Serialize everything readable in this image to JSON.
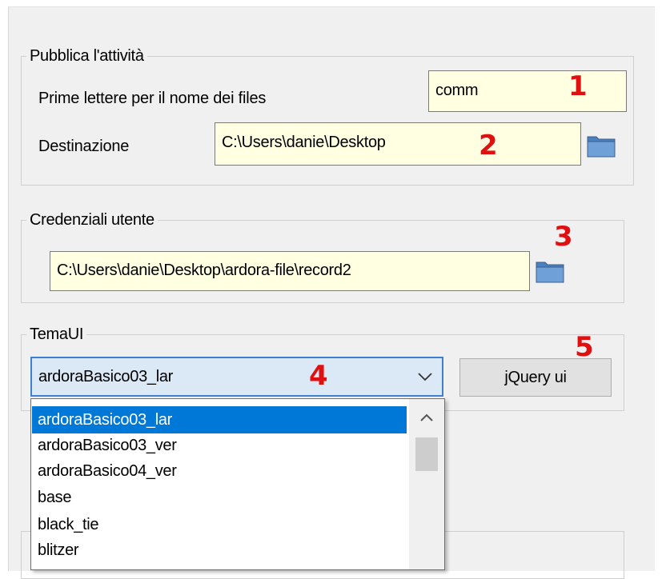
{
  "publish": {
    "legend": "Pubblica l'attività",
    "prefix_label": "Prime lettere per il nome dei files",
    "prefix_value": "comm",
    "destination_label": "Destinazione",
    "destination_value": "C:\\Users\\danie\\Desktop"
  },
  "credentials": {
    "legend": "Credenziali utente",
    "path_value": "C:\\Users\\danie\\Desktop\\ardora-file\\record2"
  },
  "theme": {
    "legend": "TemaUI",
    "selected": "ardoraBasico03_lar",
    "button_label": "jQuery ui",
    "options": [
      "ardoraBasico03_lar",
      "ardoraBasico03_ver",
      "ardoraBasico04_ver",
      "base",
      "black_tie",
      "blitzer"
    ]
  },
  "annotations": [
    "1",
    "2",
    "3",
    "4",
    "5"
  ],
  "colors": {
    "field_background": "#ffffe1",
    "selection": "#0078d7",
    "annotation": "#e01010",
    "select_background": "#dbe9f7"
  },
  "icons": {
    "folder": "folder-icon",
    "dropdown": "chevron-down-icon",
    "scroll_up": "chevron-up-icon"
  }
}
